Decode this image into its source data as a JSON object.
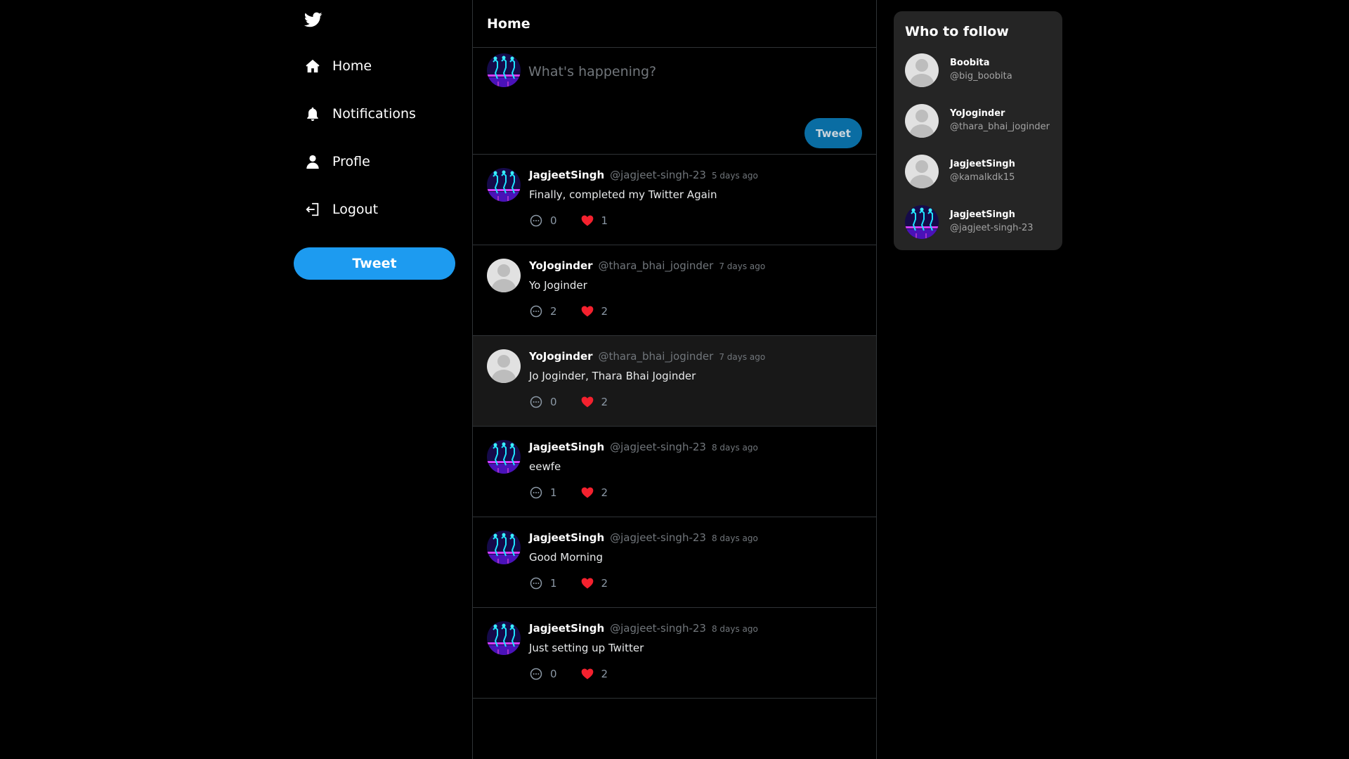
{
  "nav": {
    "logo_icon": "twitter-bird-icon",
    "items": [
      {
        "label": "Home",
        "icon": "home-icon"
      },
      {
        "label": "Notifications",
        "icon": "bell-icon"
      },
      {
        "label": "Profle",
        "icon": "user-icon"
      },
      {
        "label": "Logout",
        "icon": "logout-icon"
      }
    ],
    "tweet_button": "Tweet"
  },
  "feed": {
    "title": "Home",
    "composer": {
      "placeholder": "What's happening?",
      "tweet_button": "Tweet"
    },
    "tweets": [
      {
        "name": "JagjeetSingh",
        "handle": "@jagjeet-singh-23",
        "time": "5 days ago",
        "text": "Finally, completed my Twitter Again",
        "replies": "0",
        "likes": "1",
        "avatar": "neon-photo"
      },
      {
        "name": "YoJoginder",
        "handle": "@thara_bhai_joginder",
        "time": "7 days ago",
        "text": "Yo Joginder",
        "replies": "2",
        "likes": "2",
        "avatar": "default"
      },
      {
        "name": "YoJoginder",
        "handle": "@thara_bhai_joginder",
        "time": "7 days ago",
        "text": "Jo Joginder, Thara Bhai Joginder",
        "replies": "0",
        "likes": "2",
        "avatar": "default"
      },
      {
        "name": "JagjeetSingh",
        "handle": "@jagjeet-singh-23",
        "time": "8 days ago",
        "text": "eewfe",
        "replies": "1",
        "likes": "2",
        "avatar": "neon-photo"
      },
      {
        "name": "JagjeetSingh",
        "handle": "@jagjeet-singh-23",
        "time": "8 days ago",
        "text": "Good Morning",
        "replies": "1",
        "likes": "2",
        "avatar": "neon-photo"
      },
      {
        "name": "JagjeetSingh",
        "handle": "@jagjeet-singh-23",
        "time": "8 days ago",
        "text": "Just setting up Twitter",
        "replies": "0",
        "likes": "2",
        "avatar": "neon-photo"
      }
    ]
  },
  "who_to_follow": {
    "title": "Who to follow",
    "users": [
      {
        "name": "Boobita",
        "handle": "@big_boobita",
        "avatar": "default"
      },
      {
        "name": "YoJoginder",
        "handle": "@thara_bhai_joginder",
        "avatar": "default"
      },
      {
        "name": "JagjeetSingh",
        "handle": "@kamalkdk15",
        "avatar": "default"
      },
      {
        "name": "JagjeetSingh",
        "handle": "@jagjeet-singh-23",
        "avatar": "neon-photo"
      }
    ]
  },
  "colors": {
    "accent": "#1d9bf0",
    "like": "#f91880",
    "background": "#000000",
    "panel": "#252525"
  }
}
